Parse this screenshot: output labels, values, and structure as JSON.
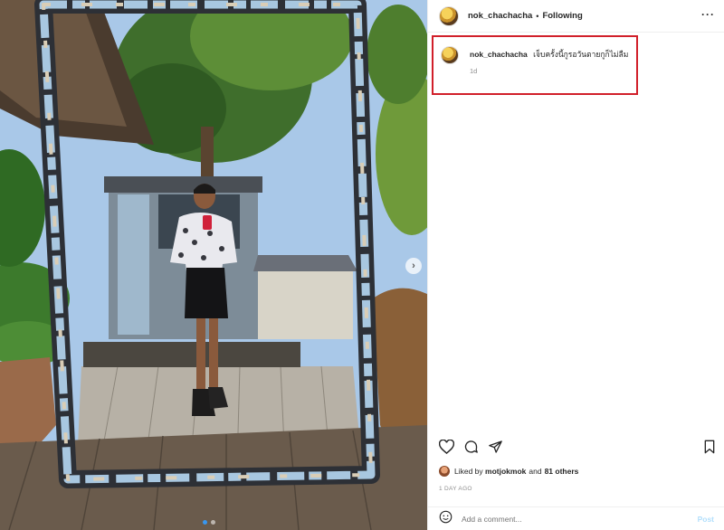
{
  "post": {
    "username": "nok_chachacha",
    "separator": "•",
    "follow_status": "Following",
    "more_icon": "more-horizontal-icon"
  },
  "caption": {
    "username": "nok_chachacha",
    "text": "เจ็บครั้งนี้กูรอวันตายกูก็ไม่ลืม",
    "time": "1d",
    "highlight_color": "#d11f2a"
  },
  "actions": {
    "like_icon": "heart-icon",
    "comment_icon": "comment-icon",
    "share_icon": "send-icon",
    "save_icon": "bookmark-icon"
  },
  "likes": {
    "prefix": "Liked by",
    "user": "motjokmok",
    "middle": "and",
    "others": "81 others"
  },
  "date": "1 DAY AGO",
  "comment": {
    "placeholder": "Add a comment...",
    "post_label": "Post",
    "emoji_icon": "smiley-icon"
  },
  "carousel": {
    "next_glyph": "›",
    "total": 2,
    "current": 1
  }
}
